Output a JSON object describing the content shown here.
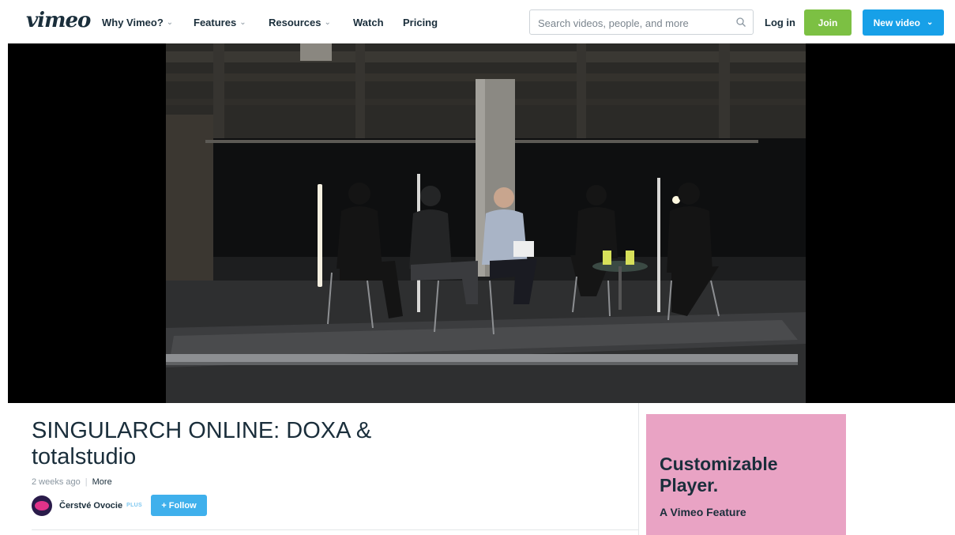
{
  "header": {
    "logo": "vimeo",
    "nav": [
      {
        "label": "Why Vimeo?",
        "has_dropdown": true
      },
      {
        "label": "Features",
        "has_dropdown": true
      },
      {
        "label": "Resources",
        "has_dropdown": true
      },
      {
        "label": "Watch",
        "has_dropdown": false
      },
      {
        "label": "Pricing",
        "has_dropdown": false
      }
    ],
    "search_placeholder": "Search videos, people, and more",
    "login_label": "Log in",
    "join_label": "Join",
    "new_video_label": "New video"
  },
  "video": {
    "title": "SINGULARCH ONLINE: DOXA & totalstudio",
    "posted": "2 weeks ago",
    "more_label": "More",
    "channel_name": "Čerstvé Ovocie",
    "channel_badge": "PLUS",
    "follow_label": "+ Follow"
  },
  "ad": {
    "headline": "Customizable Player.",
    "subline": "A Vimeo Feature"
  },
  "colors": {
    "join": "#7cc043",
    "new_video": "#17a0e8",
    "follow": "#3fb0ec",
    "ad_background": "#e9a3c4",
    "text": "#1a2e3b"
  },
  "icons": {
    "search": "search-icon",
    "chevron": "chevron-down-icon"
  }
}
